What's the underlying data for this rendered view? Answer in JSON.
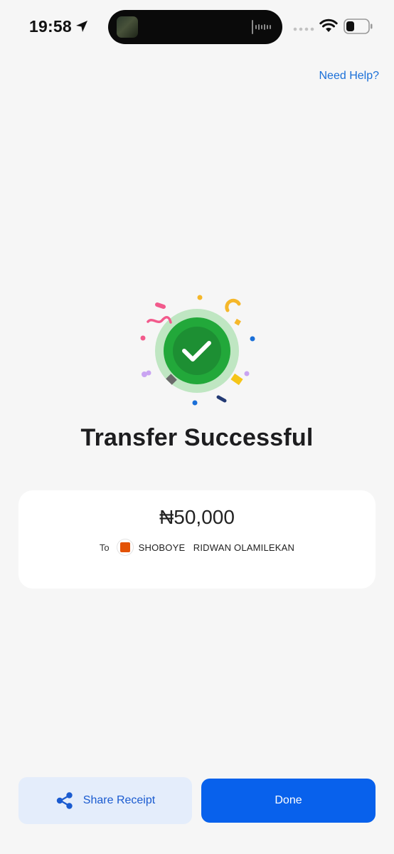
{
  "status_bar": {
    "time": "19:58",
    "icons": [
      "location-arrow-icon",
      "cellular-dots-icon",
      "wifi-icon",
      "battery-icon"
    ]
  },
  "header": {
    "help_link": "Need Help?"
  },
  "main": {
    "title": "Transfer Successful",
    "success_icon": "check-circle-icon",
    "colors": {
      "success_green": "#22a83a",
      "success_halo": "#bfe6c2",
      "primary_blue": "#0861ec",
      "link_blue": "#1a6fd8",
      "secondary_button_bg": "#e4edfb"
    }
  },
  "receipt_card": {
    "amount": "₦50,000",
    "to_label": "To",
    "recipient_name": "SHOBOYE   RIDWAN OLAMILEKAN",
    "bank_logo": "gtbank-logo"
  },
  "actions": {
    "share_label": "Share Receipt",
    "share_icon": "share-icon",
    "done_label": "Done"
  }
}
